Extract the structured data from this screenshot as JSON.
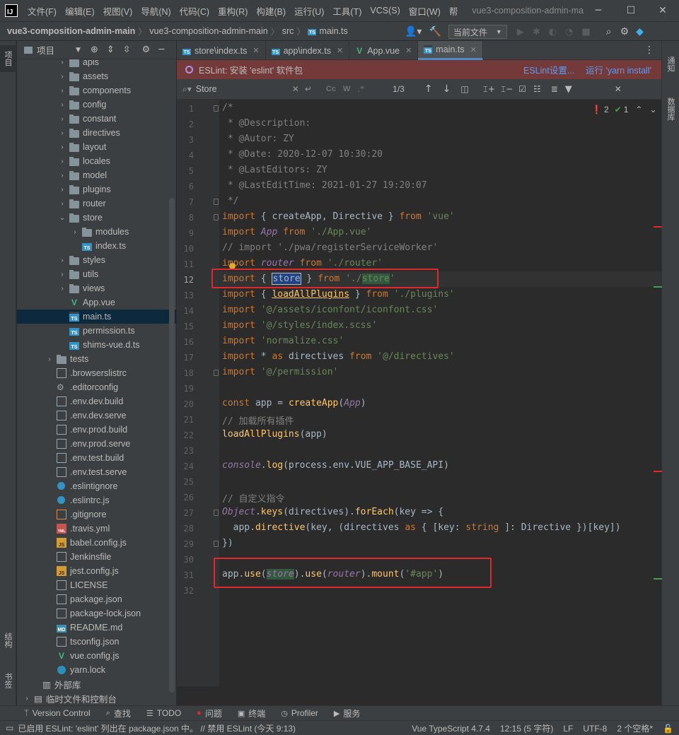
{
  "window": {
    "menus": [
      "文件(F)",
      "编辑(E)",
      "视图(V)",
      "导航(N)",
      "代码(C)",
      "重构(R)",
      "构建(B)",
      "运行(U)",
      "工具(T)",
      "VCS(S)",
      "窗口(W)",
      "帮"
    ],
    "title": "vue3-composition-admin-ma",
    "controls": [
      "minimize-icon",
      "maximize-icon",
      "close-icon"
    ]
  },
  "nav": {
    "crumbs": [
      "vue3-composition-admin-main",
      "vue3-composition-admin-main",
      "src",
      "main.ts"
    ],
    "run_config": "当前文件"
  },
  "left_strip": {
    "project": "项目",
    "structure": "结构",
    "bookmarks": "书签"
  },
  "right_strip": {
    "notifications": "通知",
    "database": "数据库"
  },
  "project_panel": {
    "title": "项目",
    "tree": [
      {
        "label": "apis",
        "type": "folder",
        "depth": 1,
        "arrow": "›"
      },
      {
        "label": "assets",
        "type": "folder",
        "depth": 1,
        "arrow": "›"
      },
      {
        "label": "components",
        "type": "folder",
        "depth": 1,
        "arrow": "›"
      },
      {
        "label": "config",
        "type": "folder",
        "depth": 1,
        "arrow": "›"
      },
      {
        "label": "constant",
        "type": "folder",
        "depth": 1,
        "arrow": "›"
      },
      {
        "label": "directives",
        "type": "folder",
        "depth": 1,
        "arrow": "›"
      },
      {
        "label": "layout",
        "type": "folder",
        "depth": 1,
        "arrow": "›"
      },
      {
        "label": "locales",
        "type": "folder",
        "depth": 1,
        "arrow": "›"
      },
      {
        "label": "model",
        "type": "folder",
        "depth": 1,
        "arrow": "›"
      },
      {
        "label": "plugins",
        "type": "folder",
        "depth": 1,
        "arrow": "›"
      },
      {
        "label": "router",
        "type": "folder",
        "depth": 1,
        "arrow": "›"
      },
      {
        "label": "store",
        "type": "folder",
        "depth": 1,
        "arrow": "⌄"
      },
      {
        "label": "modules",
        "type": "folder",
        "depth": 2,
        "arrow": "›"
      },
      {
        "label": "index.ts",
        "type": "ts",
        "depth": 2,
        "arrow": ""
      },
      {
        "label": "styles",
        "type": "folder",
        "depth": 1,
        "arrow": "›"
      },
      {
        "label": "utils",
        "type": "folder",
        "depth": 1,
        "arrow": "›"
      },
      {
        "label": "views",
        "type": "folder",
        "depth": 1,
        "arrow": "›"
      },
      {
        "label": "App.vue",
        "type": "vue",
        "depth": 1,
        "arrow": ""
      },
      {
        "label": "main.ts",
        "type": "ts",
        "depth": 1,
        "arrow": ""
      },
      {
        "label": "permission.ts",
        "type": "ts",
        "depth": 1,
        "arrow": ""
      },
      {
        "label": "shims-vue.d.ts",
        "type": "ts",
        "depth": 1,
        "arrow": ""
      },
      {
        "label": "tests",
        "type": "folder",
        "depth": 0,
        "arrow": "›"
      },
      {
        "label": ".browserslistrc",
        "type": "file",
        "depth": 0,
        "arrow": ""
      },
      {
        "label": ".editorconfig",
        "type": "gear",
        "depth": 0,
        "arrow": ""
      },
      {
        "label": ".env.dev.build",
        "type": "file",
        "depth": 0,
        "arrow": ""
      },
      {
        "label": ".env.dev.serve",
        "type": "file",
        "depth": 0,
        "arrow": ""
      },
      {
        "label": ".env.prod.build",
        "type": "file",
        "depth": 0,
        "arrow": ""
      },
      {
        "label": ".env.prod.serve",
        "type": "file",
        "depth": 0,
        "arrow": ""
      },
      {
        "label": ".env.test.build",
        "type": "file",
        "depth": 0,
        "arrow": ""
      },
      {
        "label": ".env.test.serve",
        "type": "file",
        "depth": 0,
        "arrow": ""
      },
      {
        "label": ".eslintignore",
        "type": "dot",
        "depth": 0,
        "arrow": ""
      },
      {
        "label": ".eslintrc.js",
        "type": "dot",
        "depth": 0,
        "arrow": ""
      },
      {
        "label": ".gitignore",
        "type": "git",
        "depth": 0,
        "arrow": ""
      },
      {
        "label": ".travis.yml",
        "type": "yml",
        "depth": 0,
        "arrow": ""
      },
      {
        "label": "babel.config.js",
        "type": "js",
        "depth": 0,
        "arrow": ""
      },
      {
        "label": "Jenkinsfile",
        "type": "file",
        "depth": 0,
        "arrow": ""
      },
      {
        "label": "jest.config.js",
        "type": "js",
        "depth": 0,
        "arrow": ""
      },
      {
        "label": "LICENSE",
        "type": "file",
        "depth": 0,
        "arrow": ""
      },
      {
        "label": "package.json",
        "type": "file",
        "depth": 0,
        "arrow": ""
      },
      {
        "label": "package-lock.json",
        "type": "file",
        "depth": 0,
        "arrow": ""
      },
      {
        "label": "README.md",
        "type": "md",
        "depth": 0,
        "arrow": ""
      },
      {
        "label": "tsconfig.json",
        "type": "file",
        "depth": 0,
        "arrow": ""
      },
      {
        "label": "vue.config.js",
        "type": "vue",
        "depth": 0,
        "arrow": ""
      },
      {
        "label": "yarn.lock",
        "type": "yarn",
        "depth": 0,
        "arrow": ""
      }
    ],
    "external_libs": "外部库",
    "scratches": "临时文件和控制台"
  },
  "tabs": [
    {
      "label": "store\\index.ts",
      "type": "ts"
    },
    {
      "label": "app\\index.ts",
      "type": "ts"
    },
    {
      "label": "App.vue",
      "type": "vue"
    },
    {
      "label": "main.ts",
      "type": "ts",
      "active": true
    }
  ],
  "banner": {
    "text": "ESLint: 安装 'eslint' 软件包",
    "settings_link": "ESLint设置...",
    "run_link": "运行 'yarn install'"
  },
  "search": {
    "value": "Store",
    "cc": "Cc",
    "w": "W",
    "count": "1/3"
  },
  "inspections": {
    "errors": "2",
    "ok": "1"
  },
  "status_colors": {
    "accent": "#4a88c7",
    "error_mark": "#e0282e",
    "change_mark": "#499c54"
  },
  "bottom_tools": [
    "Version Control",
    "查找",
    "TODO",
    "问题",
    "终端",
    "Profiler",
    "服务"
  ],
  "status": {
    "message": "已启用 ESLint: 'eslint' 列出在 package.json 中。 // 禁用 ESLint (今天 9:13)",
    "language": "Vue TypeScript 4.7.4",
    "position": "12:15 (5 字符)",
    "line_sep": "LF",
    "encoding": "UTF-8",
    "indent": "2 个空格*"
  }
}
